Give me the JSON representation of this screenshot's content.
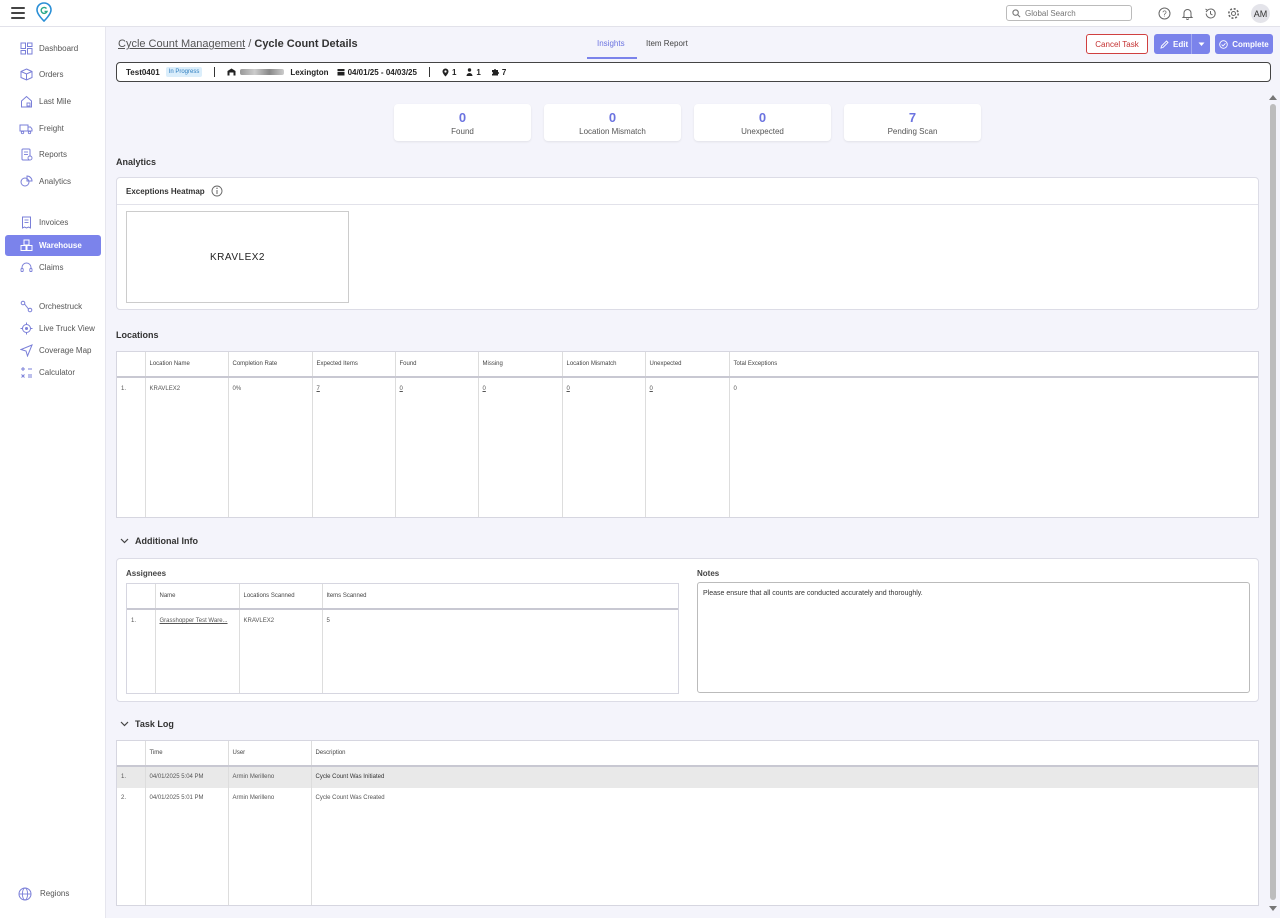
{
  "topbar": {
    "search_placeholder": "Global Search",
    "avatar_initials": "AM",
    "icons": [
      "help-icon",
      "bell-icon",
      "history-icon",
      "gear-icon"
    ]
  },
  "sidebar": {
    "items": [
      {
        "label": "Dashboard",
        "icon": "dashboard-icon"
      },
      {
        "label": "Orders",
        "icon": "box-icon"
      },
      {
        "label": "Last Mile",
        "icon": "home-delivery-icon"
      },
      {
        "label": "Freight",
        "icon": "truck-icon"
      },
      {
        "label": "Reports",
        "icon": "report-icon"
      },
      {
        "label": "Analytics",
        "icon": "analytics-icon"
      },
      {
        "label": "Invoices",
        "icon": "invoice-icon"
      },
      {
        "label": "Warehouse",
        "icon": "warehouse-icon",
        "active": true
      },
      {
        "label": "Claims",
        "icon": "headset-icon"
      },
      {
        "label": "Orchestruck",
        "icon": "route-icon"
      },
      {
        "label": "Live Truck View",
        "icon": "target-icon"
      },
      {
        "label": "Coverage Map",
        "icon": "navigation-icon"
      },
      {
        "label": "Calculator",
        "icon": "calculator-icon"
      }
    ],
    "bottom_item": {
      "label": "Regions",
      "icon": "globe-icon"
    }
  },
  "header": {
    "breadcrumb_parent": "Cycle Count Management",
    "breadcrumb_separator": "/",
    "breadcrumb_current": "Cycle Count Details",
    "tabs": [
      {
        "label": "Insights",
        "active": true
      },
      {
        "label": "Item Report",
        "active": false
      }
    ],
    "cancel_label": "Cancel Task",
    "edit_label": "Edit",
    "complete_label": "Complete"
  },
  "summary": {
    "code": "Test0401",
    "status": "In Progress",
    "city": "Lexington",
    "date_range": "04/01/25 - 04/03/25",
    "locations_count": "1",
    "assignees_count": "1",
    "items_count": "7"
  },
  "stats": [
    {
      "value": "0",
      "label": "Found"
    },
    {
      "value": "0",
      "label": "Location Mismatch"
    },
    {
      "value": "0",
      "label": "Unexpected"
    },
    {
      "value": "7",
      "label": "Pending Scan"
    }
  ],
  "analytics": {
    "title": "Analytics",
    "heatmap_title": "Exceptions Heatmap",
    "heatmap_tile": "KRAVLEX2"
  },
  "locations": {
    "title": "Locations",
    "columns": [
      "",
      "Location Name",
      "Completion Rate",
      "Expected Items",
      "Found",
      "Missing",
      "Location Mismatch",
      "Unexpected",
      "Total Exceptions"
    ],
    "rows": [
      [
        "1.",
        "KRAVLEX2",
        "0%",
        "7",
        "0",
        "0",
        "0",
        "0",
        "0"
      ]
    ]
  },
  "additional_info": {
    "title": "Additional Info",
    "assignees_title": "Assignees",
    "assignee_columns": [
      "",
      "Name",
      "Locations Scanned",
      "Items Scanned"
    ],
    "assignee_rows": [
      [
        "1.",
        "Grasshopper Test Ware...",
        "KRAVLEX2",
        "5"
      ]
    ],
    "notes_title": "Notes",
    "notes_text": "Please ensure that all counts are conducted accurately and thoroughly."
  },
  "task_log": {
    "title": "Task Log",
    "columns": [
      "",
      "Time",
      "User",
      "Description"
    ],
    "rows": [
      [
        "1.",
        "04/01/2025 5:04 PM",
        "Armin Merilleno",
        "Cycle Count Was Initiated"
      ],
      [
        "2.",
        "04/01/2025 5:01 PM",
        "Armin Merilleno",
        "Cycle Count Was Created"
      ]
    ]
  }
}
